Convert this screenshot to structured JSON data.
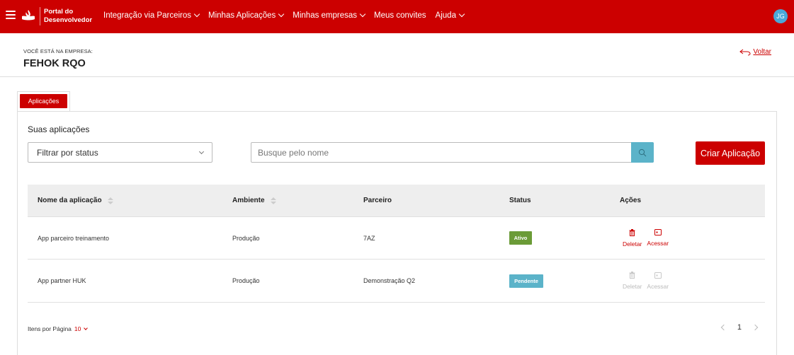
{
  "header": {
    "portal_line1": "Portal do",
    "portal_line2": "Desenvolvedor",
    "nav": [
      {
        "label": "Integração via Parceiros",
        "dropdown": true
      },
      {
        "label": "Minhas Aplicações",
        "dropdown": true
      },
      {
        "label": "Minhas empresas",
        "dropdown": true
      },
      {
        "label": "Meus convites",
        "dropdown": false
      },
      {
        "label": "Ajuda",
        "dropdown": true
      }
    ],
    "avatar": "JG",
    "brand_color": "#cc0000"
  },
  "company": {
    "label": "VOCÊ ESTÁ NA EMPRESA:",
    "name": "FEHOK RQO",
    "back_label": "Voltar"
  },
  "tabs": [
    {
      "label": "Aplicações",
      "active": true
    }
  ],
  "main": {
    "title": "Suas aplicações",
    "filter_placeholder": "Filtrar por status",
    "search_placeholder": "Busque pelo nome",
    "create_label": "Criar Aplicação"
  },
  "table": {
    "columns": [
      "Nome da aplicação",
      "Ambiente",
      "Parceiro",
      "Status",
      "Ações"
    ],
    "rows": [
      {
        "name": "App parceiro treinamento",
        "env": "Produção",
        "partner": "7AZ",
        "status": "Ativo",
        "status_color": "#6b9b37",
        "delete": "Deletar",
        "access": "Acessar",
        "actions_enabled": true
      },
      {
        "name": "App partner HUK",
        "env": "Produção",
        "partner": "Demonstração Q2",
        "status": "Pendente",
        "status_color": "#5bb3c9",
        "delete": "Deletar",
        "access": "Acessar",
        "actions_enabled": false
      }
    ]
  },
  "pagination": {
    "per_page_label": "Itens por Página",
    "per_page_value": "10",
    "current_page": "1"
  }
}
